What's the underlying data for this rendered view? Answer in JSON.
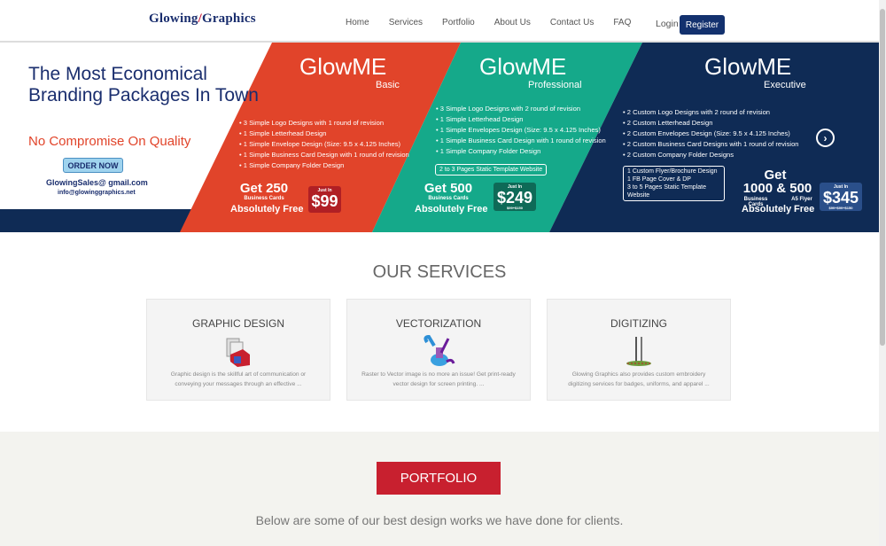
{
  "header": {
    "logo_part1": "Glowing",
    "logo_slash": "/",
    "logo_part2": "Graphics",
    "nav": [
      "Home",
      "Services",
      "Portfolio",
      "About Us",
      "Contact Us",
      "FAQ"
    ],
    "login": "Login",
    "register": "Register"
  },
  "banner": {
    "title": "The Most Economical Branding Packages In Town",
    "subtitle": "No Compromise On Quality",
    "order_button": "ORDER NOW",
    "email1": "GlowingSales@ gmail.com",
    "email2": "info@glowinggraphics.net",
    "packages": [
      {
        "name": "GlowME",
        "tier": "Basic",
        "features": [
          "3 Simple Logo Designs with 1 round of revision",
          "1 Simple Letterhead Design",
          "1 Simple Envelope Design (Size: 9.5 x 4.125 Inches)",
          "1 Simple Business Card Design with 1 round of revision",
          "1 Simple Company Folder Design"
        ],
        "get": "Get 250",
        "get_sub": "Business Cards",
        "free": "Absolutely Free",
        "just_in": "Just In",
        "price": "$99"
      },
      {
        "name": "GlowME",
        "tier": "Professional",
        "features": [
          "3 Simple Logo Designs with 2 round of revision",
          "1 Simple Letterhead Design",
          "1 Simple Envelopes Design (Size: 9.5 x 4.125 Inches)",
          "1 Simple Business Card Design with 1 round of revision",
          "1 Simple Company Folder Design"
        ],
        "extra": "2 to 3 Pages Static Template Website",
        "get": "Get 500",
        "get_sub": "Business Cards",
        "free": "Absolutely Free",
        "just_in": "Just In",
        "price": "$249",
        "price_fine": "$99+$150"
      },
      {
        "name": "GlowME",
        "tier": "Executive",
        "features": [
          "2 Custom Logo Designs with 2 round of revision",
          "2 Custom Letterhead Design",
          "2 Custom Envelopes Design (Size: 9.5 x 4.125 Inches)",
          "2 Custom Business Card Designs with 1 round of revision",
          "2 Custom Company Folder Designs"
        ],
        "extras": [
          "1 Custom Flyer/Brochure Design",
          "1 FB Page Cover & DP",
          "3 to 5 Pages Static Template Website"
        ],
        "get1": "Get",
        "get2": "1000 & 500",
        "sub_left": "Business Cards",
        "sub_right": "A5 Flyer",
        "free_left": "Absolutely",
        "free_right": "Free",
        "just_in": "Just In",
        "price": "$345",
        "price_fine": "$99+$99+$150"
      }
    ]
  },
  "services": {
    "title": "OUR SERVICES",
    "cards": [
      {
        "title": "GRAPHIC DESIGN",
        "text": "Graphic design is the skillful art of communication or conveying your messages through an effective ..."
      },
      {
        "title": "VECTORIZATION",
        "text": "Raster to Vector image is no more an issue! Get print-ready vector design for screen printing. ..."
      },
      {
        "title": "DIGITIZING",
        "text": "Glowing Graphics also provides custom embroidery digitizing services for badges, uniforms, and apparel ..."
      }
    ]
  },
  "portfolio": {
    "button": "PORTFOLIO",
    "text": "Below are some of our best design works we have done for clients."
  },
  "colors": {
    "navy": "#13316e",
    "coral": "#e1442a",
    "teal": "#15a98a",
    "dark_navy": "#0f2b55",
    "portfolio_red": "#c8202f"
  }
}
